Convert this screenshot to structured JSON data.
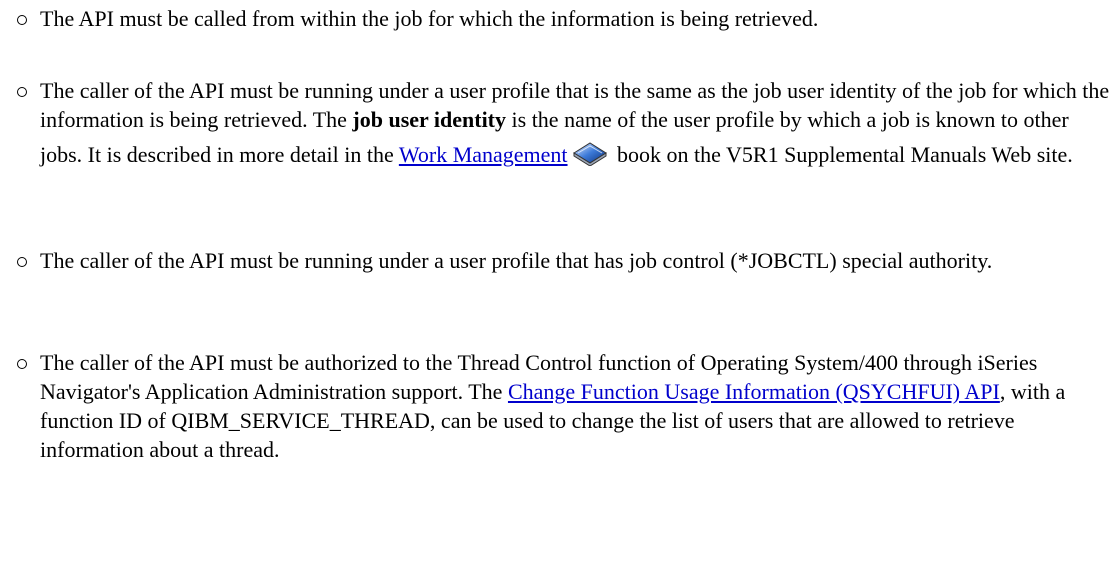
{
  "items": [
    {
      "text": "The API must be called from within the job for which the information is being retrieved."
    },
    {
      "part1": "The caller of the API must be running under a user profile that is the same as the job user identity of the job for which the information is being retrieved. The ",
      "bold": "job user identity",
      "part2": " is the name of the user profile by which a job is known to other jobs. It is described in more detail in the ",
      "link": "Work Management",
      "icon": "book-icon",
      "part3": " book on the V5R1 Supplemental Manuals Web site."
    },
    {
      "text": "The caller of the API must be running under a user profile that has job control (*JOBCTL) special authority."
    },
    {
      "part1": "The caller of the API must be authorized to the Thread Control function of Operating System/400 through iSeries Navigator's Application Administration support. The ",
      "link": "Change Function Usage Information (QSYCHFUI) API",
      "part2": ", with a function ID of QIBM_SERVICE_THREAD, can be used to change the list of users that are allowed to retrieve information about a thread."
    }
  ],
  "colors": {
    "link": "#0000cc",
    "text": "#000000"
  }
}
